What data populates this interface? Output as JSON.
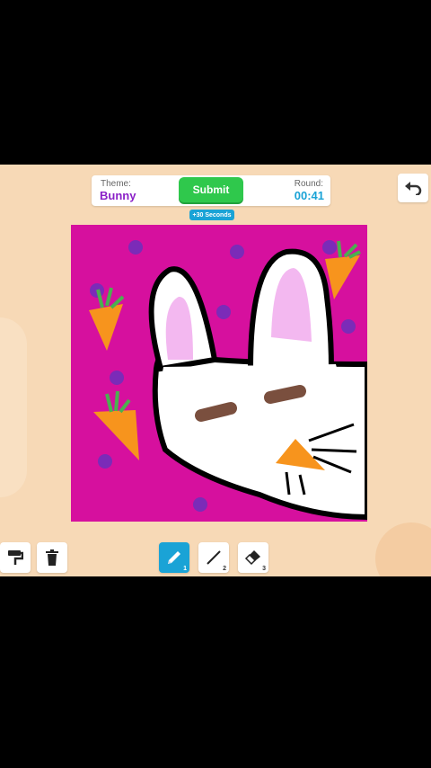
{
  "header": {
    "theme_label": "Theme:",
    "theme_value": "Bunny",
    "submit_label": "Submit",
    "round_label": "Round:",
    "round_value": "00:41",
    "bonus_badge": "+30 Seconds"
  },
  "toolbar": {
    "left_tools": [
      {
        "name": "paint-roller-icon"
      },
      {
        "name": "trash-icon"
      }
    ],
    "draw_tools": [
      {
        "name": "pencil-icon",
        "number": "1",
        "active": true
      },
      {
        "name": "line-icon",
        "number": "2",
        "active": false
      },
      {
        "name": "eraser-icon",
        "number": "3",
        "active": false
      }
    ]
  },
  "colors": {
    "background": "#f7d9b6",
    "canvas_magenta": "#d6109e",
    "accent_blue": "#1aa3d6",
    "submit_green": "#2fc84c",
    "theme_purple": "#8a1fc7",
    "carrot_orange": "#f7941d",
    "dots_purple": "#7b2bb8"
  }
}
